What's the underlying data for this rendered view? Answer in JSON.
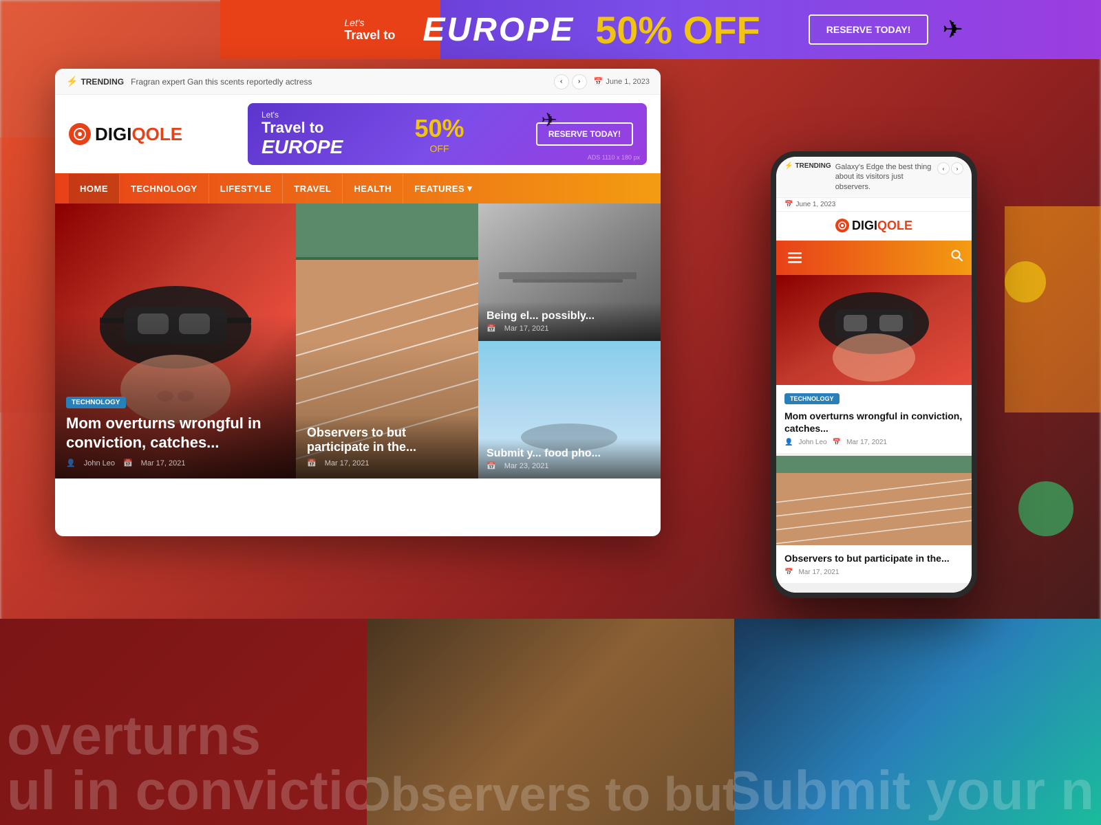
{
  "site": {
    "name": "DIGIQOLE",
    "name_highlight": "QOLE",
    "logo_icon": "D"
  },
  "trending_bar": {
    "label": "TRENDING",
    "text": "Fragran expert Gan this scents reportedly actress",
    "date": "June 1, 2023",
    "prev_label": "‹",
    "next_label": "›"
  },
  "ad_banner": {
    "lets": "Let's",
    "travel_to": "Travel to",
    "europe": "EUROPE",
    "discount": "50%",
    "off": "OFF",
    "cta": "RESERVE TODAY!",
    "small_text": "ADS 1110 x 180 px"
  },
  "navigation": {
    "items": [
      {
        "label": "HOME",
        "active": true
      },
      {
        "label": "TECHNOLOGY"
      },
      {
        "label": "LIFESTYLE"
      },
      {
        "label": "TRAVEL"
      },
      {
        "label": "HEALTH"
      },
      {
        "label": "FEATURES",
        "has_dropdown": true
      }
    ]
  },
  "articles": [
    {
      "category": "TECHNOLOGY",
      "title": "Mom overturns wrongful in conviction, catches...",
      "author": "John Leo",
      "date": "Mar 17, 2021",
      "type": "main"
    },
    {
      "title": "Observers to but participate in the...",
      "date": "Mar 17, 2021",
      "type": "center"
    },
    {
      "title": "Being el... possibly...",
      "date": "Mar 17, 2021",
      "type": "right-top"
    },
    {
      "title": "Submit y... food pho...",
      "date": "Mar 23, 2021",
      "type": "right-bottom"
    }
  ],
  "mobile": {
    "trending": {
      "label": "TRENDING",
      "text": "Galaxy's Edge the best thing about its visitors just observers.",
      "date": "June 1, 2023",
      "prev_label": "‹",
      "next_label": "›"
    },
    "logo": {
      "name": "DIGIQOLE",
      "highlight": "QOLE"
    },
    "articles": [
      {
        "category": "TECHNOLOGY",
        "title": "Mom overturns wrongful in conviction, catches...",
        "author": "John Leo",
        "date": "Mar 17, 2021"
      },
      {
        "title": "Observers to but participate in the...",
        "date": "Mar 17, 2021"
      }
    ]
  },
  "bg_texts": {
    "left": "overturns\nul in conviction,",
    "center": "Observers to but",
    "right": "Submit your n"
  },
  "top_banner": {
    "europe_text": "EUROPE",
    "discount": "50% OFF"
  },
  "colors": {
    "primary": "#e84118",
    "secondary": "#f39c12",
    "accent_blue": "#2980b9",
    "purple": "#7c4de8",
    "yellow": "#f1c40f",
    "dark": "#1a1a1a"
  }
}
